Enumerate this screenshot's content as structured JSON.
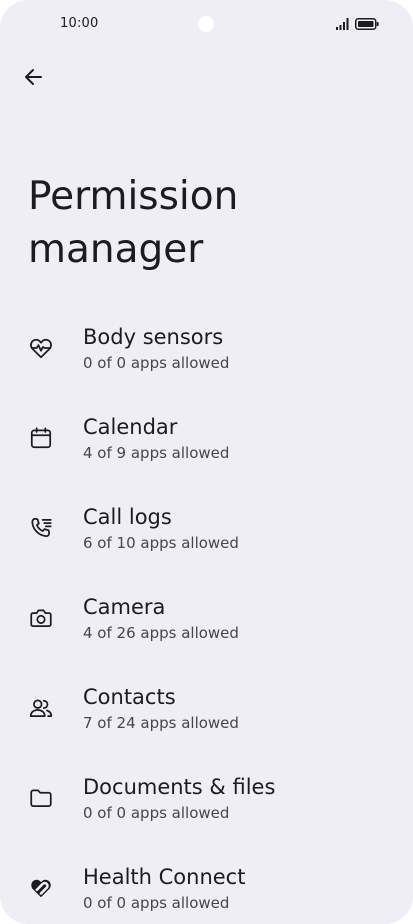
{
  "status_bar": {
    "time": "10:00",
    "icons": [
      "signal-icon",
      "battery-icon"
    ]
  },
  "toolbar": {
    "back_icon": "arrow-left-icon"
  },
  "page": {
    "title": "Permission manager"
  },
  "permissions": [
    {
      "title": "Body sensors",
      "summary": "0 of 0 apps allowed",
      "icon": "heart-pulse-icon"
    },
    {
      "title": "Calendar",
      "summary": "4 of 9 apps allowed",
      "icon": "calendar-icon"
    },
    {
      "title": "Call logs",
      "summary": "6 of 10 apps allowed",
      "icon": "call-log-icon"
    },
    {
      "title": "Camera",
      "summary": "4 of 26 apps allowed",
      "icon": "camera-icon"
    },
    {
      "title": "Contacts",
      "summary": "7 of 24 apps allowed",
      "icon": "contacts-icon"
    },
    {
      "title": "Documents & files",
      "summary": "0 of 0 apps allowed",
      "icon": "folder-icon"
    },
    {
      "title": "Health Connect",
      "summary": "0 of 0 apps allowed",
      "icon": "health-connect-icon"
    }
  ],
  "colors": {
    "background": "#f0eef5",
    "text_primary": "#1c1b1f",
    "text_secondary": "#46454d"
  }
}
